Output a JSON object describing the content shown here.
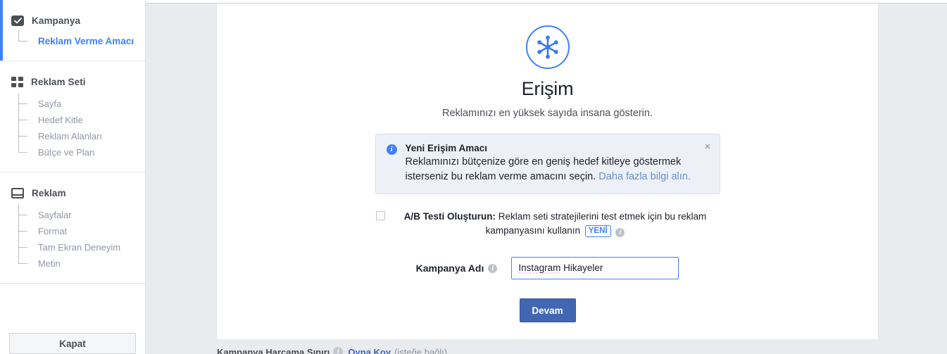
{
  "sidebar": {
    "sections": [
      {
        "id": "kampanya",
        "label": "Kampanya",
        "icon": "checkbox-checked-icon",
        "active": true,
        "items": [
          {
            "label": "Reklam Verme Amacı",
            "state": "active-link"
          }
        ]
      },
      {
        "id": "reklam-seti",
        "label": "Reklam Seti",
        "icon": "grid-icon",
        "active": false,
        "items": [
          {
            "label": "Sayfa",
            "state": "muted"
          },
          {
            "label": "Hedef Kitle",
            "state": "muted"
          },
          {
            "label": "Reklam Alanları",
            "state": "muted"
          },
          {
            "label": "Bütçe ve Plan",
            "state": "muted"
          }
        ]
      },
      {
        "id": "reklam",
        "label": "Reklam",
        "icon": "ad-card-icon",
        "active": false,
        "items": [
          {
            "label": "Sayfalar",
            "state": "muted"
          },
          {
            "label": "Format",
            "state": "muted"
          },
          {
            "label": "Tam Ekran Deneyim",
            "state": "muted"
          },
          {
            "label": "Metin",
            "state": "muted"
          }
        ]
      }
    ],
    "close_button": "Kapat"
  },
  "main": {
    "objective_icon": "reach-spokes-icon",
    "title": "Erişim",
    "subtitle": "Reklamınızı en yüksek sayıda insana gösterin.",
    "banner": {
      "icon": "info-icon",
      "title": "Yeni Erişim Amacı",
      "body": "Reklamınızı bütçenize göre en geniş hedef kitleye göstermek isterseniz bu reklam verme amacını seçin.",
      "link": "Daha fazla bilgi alın.",
      "close_icon": "close-icon",
      "close_label": "×"
    },
    "ab_test": {
      "checked": false,
      "bold_text": "A/B Testi Oluşturun:",
      "text": "Reklam seti stratejilerini test etmek için bu reklam kampanyasını kullanın",
      "badge": "YENİ",
      "info_icon": "info-icon",
      "info_glyph": "i"
    },
    "campaign_name": {
      "label": "Kampanya Adı",
      "info_icon": "info-icon",
      "info_glyph": "i",
      "value": "Instagram Hikayeler",
      "misspelled_part": "Instagram",
      "rest_part": " Hikayeler",
      "placeholder": ""
    },
    "continue_button": "Devam"
  },
  "bottom_cutoff": {
    "label": "Kampanya Harcama Sınırı",
    "info_icon": "info-icon",
    "info_glyph": "i",
    "link": "Oyna Koy",
    "optional": "(isteğe bağlı)"
  },
  "colors": {
    "accent_blue": "#4080ff",
    "facebook_blue": "#4267b2",
    "banner_bg": "#edf1f7",
    "page_bg": "#e9ebee",
    "muted_text": "#9197a3"
  }
}
